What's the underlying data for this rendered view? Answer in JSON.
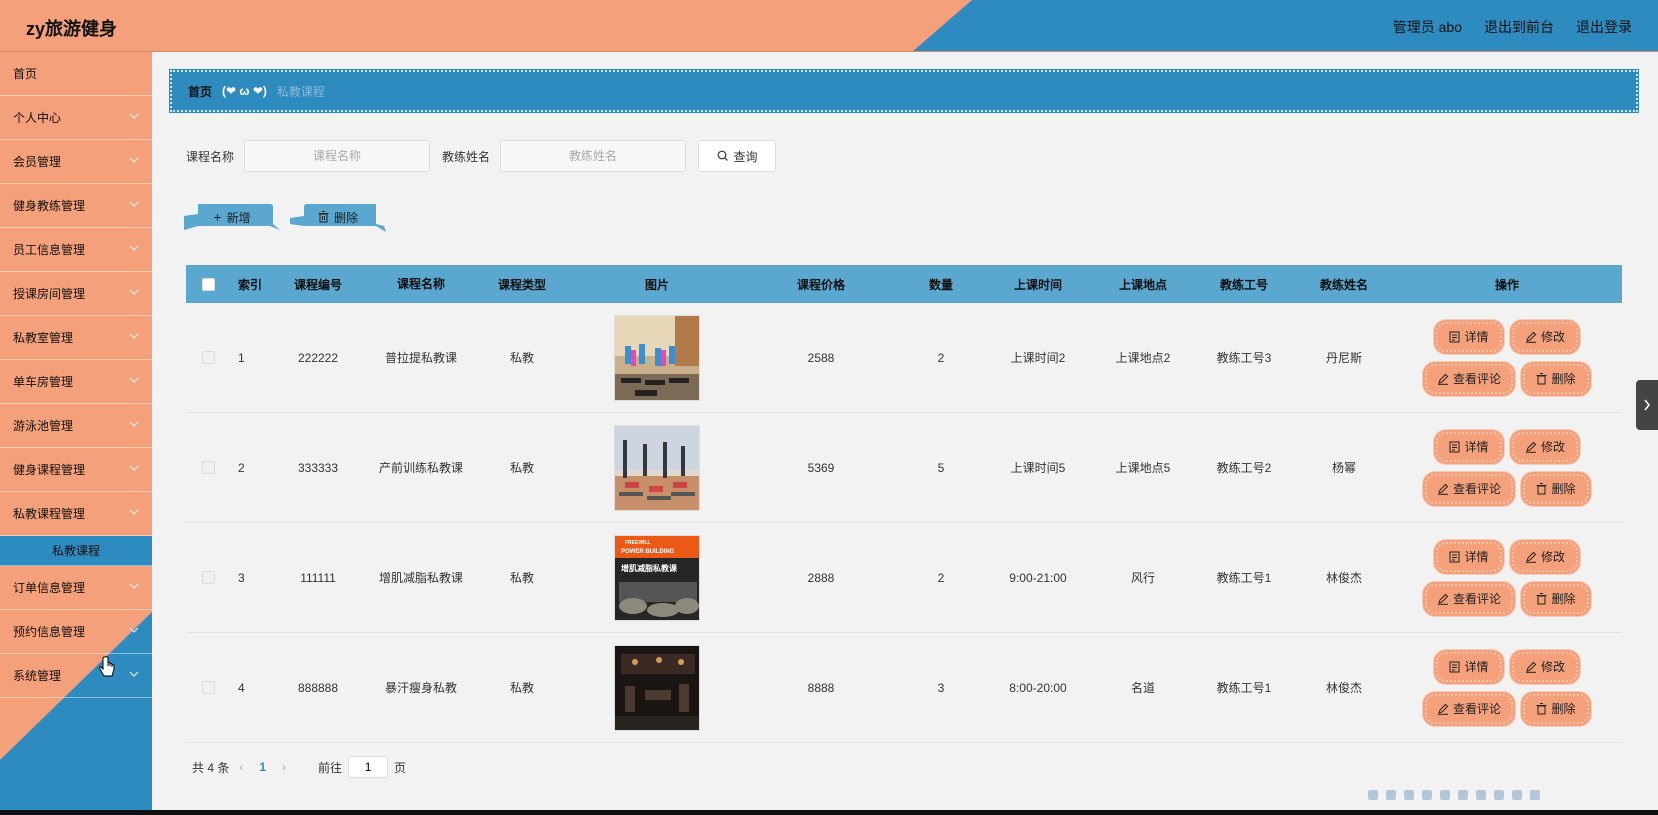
{
  "header": {
    "title": "zy旅游健身",
    "admin": "管理员 abo",
    "to_front": "退出到前台",
    "logout": "退出登录"
  },
  "sidebar": {
    "items": [
      {
        "label": "首页"
      },
      {
        "label": "个人中心"
      },
      {
        "label": "会员管理"
      },
      {
        "label": "健身教练管理"
      },
      {
        "label": "员工信息管理"
      },
      {
        "label": "授课房间管理"
      },
      {
        "label": "私教室管理"
      },
      {
        "label": "单车房管理"
      },
      {
        "label": "游泳池管理"
      },
      {
        "label": "健身课程管理"
      },
      {
        "label": "私教课程管理"
      },
      {
        "label": "订单信息管理"
      },
      {
        "label": "预约信息管理"
      },
      {
        "label": "系统管理"
      }
    ],
    "active_sub": "私教课程"
  },
  "breadcrumb": {
    "home": "首页",
    "sep": "(❤ ω ❤)",
    "current": "私教课程"
  },
  "search": {
    "course_label": "课程名称",
    "course_placeholder": "课程名称",
    "coach_label": "教练姓名",
    "coach_placeholder": "教练姓名",
    "query_label": "查询"
  },
  "actions": {
    "add_label": "新增",
    "delete_label": "删除"
  },
  "table": {
    "headers": [
      "索引",
      "课程编号",
      "课程名称",
      "课程类型",
      "图片",
      "课程价格",
      "数量",
      "上课时间",
      "上课地点",
      "教练工号",
      "教练姓名",
      "操作"
    ],
    "rows": [
      {
        "index": "1",
        "code": "222222",
        "name": "普拉提私教课",
        "type": "私教",
        "price": "2588",
        "qty": "2",
        "time": "上课时间2",
        "place": "上课地点2",
        "coach_no": "教练工号3",
        "coach_name": "丹尼斯",
        "image": "fitness-class-photo"
      },
      {
        "index": "2",
        "code": "333333",
        "name": "产前训练私教课",
        "type": "私教",
        "price": "5369",
        "qty": "5",
        "time": "上课时间5",
        "place": "上课地点5",
        "coach_no": "教练工号2",
        "coach_name": "杨幂",
        "image": "yoga-class-photo"
      },
      {
        "index": "3",
        "code": "111111",
        "name": "增肌减脂私教课",
        "type": "私教",
        "price": "2888",
        "qty": "2",
        "time": "9:00-21:00",
        "place": "风行",
        "coach_no": "教练工号1",
        "coach_name": "林俊杰",
        "image": "poster-photo",
        "poster_line1": "FREEWILL",
        "poster_line2": "POWER BUILDING",
        "poster_line3": "增肌减脂私教课"
      },
      {
        "index": "4",
        "code": "888888",
        "name": "暴汗瘦身私教",
        "type": "私教",
        "price": "8888",
        "qty": "3",
        "time": "8:00-20:00",
        "place": "名道",
        "coach_no": "教练工号1",
        "coach_name": "林俊杰",
        "image": "gym-interior-photo"
      }
    ],
    "ops": {
      "detail": "详情",
      "edit": "修改",
      "comments": "查看评论",
      "delete": "删除"
    }
  },
  "pager": {
    "total": "共 4 条",
    "current_page": "1",
    "goto": "前往",
    "goto_value": "1",
    "page_suffix": "页"
  },
  "colors": {
    "orange": "#f4a07a",
    "blue": "#2e8bc0",
    "table_header": "#5aa7cf"
  }
}
